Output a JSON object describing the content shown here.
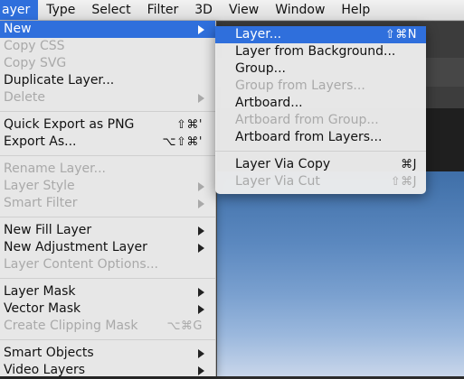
{
  "menubar": {
    "items": [
      "ayer",
      "Type",
      "Select",
      "Filter",
      "3D",
      "View",
      "Window",
      "Help"
    ]
  },
  "layer_menu": {
    "items": [
      {
        "label": "New",
        "shortcut": "",
        "submenu": true,
        "enabled": true,
        "highlighted": true
      },
      {
        "label": "Copy CSS",
        "shortcut": "",
        "submenu": false,
        "enabled": false
      },
      {
        "label": "Copy SVG",
        "shortcut": "",
        "submenu": false,
        "enabled": false
      },
      {
        "label": "Duplicate Layer...",
        "shortcut": "",
        "submenu": false,
        "enabled": true
      },
      {
        "label": "Delete",
        "shortcut": "",
        "submenu": true,
        "enabled": false
      },
      {
        "separator": true
      },
      {
        "label": "Quick Export as PNG",
        "shortcut": "⇧⌘'",
        "submenu": false,
        "enabled": true
      },
      {
        "label": "Export As...",
        "shortcut": "⌥⇧⌘'",
        "submenu": false,
        "enabled": true
      },
      {
        "separator": true
      },
      {
        "label": "Rename Layer...",
        "shortcut": "",
        "submenu": false,
        "enabled": false
      },
      {
        "label": "Layer Style",
        "shortcut": "",
        "submenu": true,
        "enabled": false
      },
      {
        "label": "Smart Filter",
        "shortcut": "",
        "submenu": true,
        "enabled": false
      },
      {
        "separator": true
      },
      {
        "label": "New Fill Layer",
        "shortcut": "",
        "submenu": true,
        "enabled": true
      },
      {
        "label": "New Adjustment Layer",
        "shortcut": "",
        "submenu": true,
        "enabled": true
      },
      {
        "label": "Layer Content Options...",
        "shortcut": "",
        "submenu": false,
        "enabled": false
      },
      {
        "separator": true
      },
      {
        "label": "Layer Mask",
        "shortcut": "",
        "submenu": true,
        "enabled": true
      },
      {
        "label": "Vector Mask",
        "shortcut": "",
        "submenu": true,
        "enabled": true
      },
      {
        "label": "Create Clipping Mask",
        "shortcut": "⌥⌘G",
        "submenu": false,
        "enabled": false
      },
      {
        "separator": true
      },
      {
        "label": "Smart Objects",
        "shortcut": "",
        "submenu": true,
        "enabled": true
      },
      {
        "label": "Video Layers",
        "shortcut": "",
        "submenu": true,
        "enabled": true
      }
    ]
  },
  "new_submenu": {
    "items": [
      {
        "label": "Layer...",
        "shortcut": "⇧⌘N",
        "enabled": true,
        "highlighted": true
      },
      {
        "label": "Layer from Background...",
        "shortcut": "",
        "enabled": true
      },
      {
        "label": "Group...",
        "shortcut": "",
        "enabled": true
      },
      {
        "label": "Group from Layers...",
        "shortcut": "",
        "enabled": false
      },
      {
        "label": "Artboard...",
        "shortcut": "",
        "enabled": true
      },
      {
        "label": "Artboard from Group...",
        "shortcut": "",
        "enabled": false
      },
      {
        "label": "Artboard from Layers...",
        "shortcut": "",
        "enabled": true
      },
      {
        "separator": true
      },
      {
        "label": "Layer Via Copy",
        "shortcut": "⌘J",
        "enabled": true
      },
      {
        "label": "Layer Via Cut",
        "shortcut": "⇧⌘J",
        "enabled": false
      }
    ]
  },
  "colors": {
    "highlight": "#2f6fdc",
    "disabled_text": "#a9a9a9",
    "menu_bg": "#ececec"
  }
}
